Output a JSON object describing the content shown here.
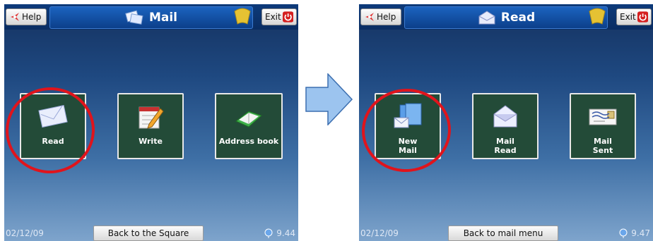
{
  "left": {
    "title": "Mail",
    "help_label": "Help",
    "exit_label": "Exit",
    "tiles": [
      {
        "label": "Read",
        "icon": "envelope-icon"
      },
      {
        "label": "Write",
        "icon": "pencil-notepad-icon"
      },
      {
        "label": "Address book",
        "icon": "address-book-icon"
      }
    ],
    "date": "02/12/09",
    "back_label": "Back to the Square",
    "indicator": "9.44"
  },
  "right": {
    "title": "Read",
    "help_label": "Help",
    "exit_label": "Exit",
    "tiles": [
      {
        "label": "New\nMail",
        "icon": "new-mail-icon"
      },
      {
        "label": "Mail\nRead",
        "icon": "open-envelope-icon"
      },
      {
        "label": "Mail\nSent",
        "icon": "sent-mail-icon"
      }
    ],
    "date": "02/12/09",
    "back_label": "Back to mail menu",
    "indicator": "9.47"
  },
  "colors": {
    "highlight_circle": "#e0141c",
    "tile_bg": "#234b38",
    "arrow": "#9cc4ef"
  }
}
